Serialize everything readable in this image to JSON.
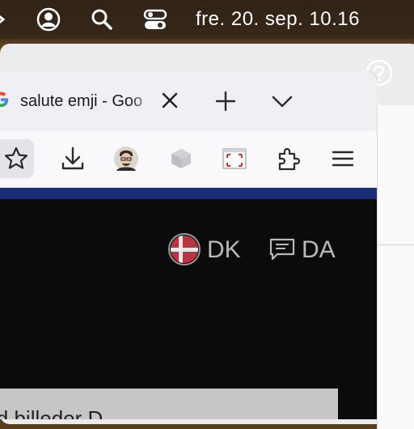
{
  "menubar": {
    "clock": "fre. 20. sep.  10.16",
    "icons": [
      "user-circle-icon",
      "search-icon",
      "control-center-icon"
    ]
  },
  "browser": {
    "tab": {
      "title": "salute emji - Goo",
      "favicon": "google-g-icon"
    },
    "toolbar_icons": [
      "star-icon",
      "download-icon",
      "profile-avatar",
      "cube-extension-icon",
      "screen-frame-extension-icon",
      "puzzle-extensions-icon",
      "menu-icon"
    ]
  },
  "page": {
    "country": "DK",
    "language": "DA",
    "partial_text": "id billeder D"
  },
  "colors": {
    "accent_bar": "#1a2e78",
    "page_bg": "#0b0b0b"
  }
}
